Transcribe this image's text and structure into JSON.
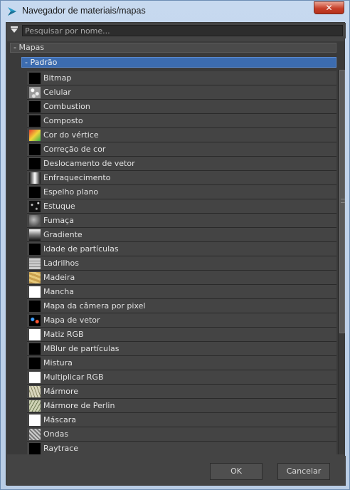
{
  "window": {
    "title": "Navegador de materiais/mapas",
    "close_label": "✕"
  },
  "search": {
    "placeholder": "Pesquisar por nome..."
  },
  "tree": {
    "group_label": "- Mapas",
    "subgroup_label": "- Padrão",
    "items": [
      {
        "label": "Bitmap",
        "thumb": "black"
      },
      {
        "label": "Celular",
        "thumb": "cellular"
      },
      {
        "label": "Combustion",
        "thumb": "black"
      },
      {
        "label": "Composto",
        "thumb": "black"
      },
      {
        "label": "Cor do vértice",
        "thumb": "vertex-color"
      },
      {
        "label": "Correção de cor",
        "thumb": "black"
      },
      {
        "label": "Deslocamento de vetor",
        "thumb": "black"
      },
      {
        "label": "Enfraquecimento",
        "thumb": "falloff"
      },
      {
        "label": "Espelho plano",
        "thumb": "black"
      },
      {
        "label": "Estuque",
        "thumb": "stucco"
      },
      {
        "label": "Fumaça",
        "thumb": "smoke"
      },
      {
        "label": "Gradiente",
        "thumb": "gradient"
      },
      {
        "label": "Idade de partículas",
        "thumb": "black"
      },
      {
        "label": "Ladrilhos",
        "thumb": "tiles"
      },
      {
        "label": "Madeira",
        "thumb": "wood"
      },
      {
        "label": "Mancha",
        "thumb": "white"
      },
      {
        "label": "Mapa da câmera por pixel",
        "thumb": "black"
      },
      {
        "label": "Mapa de vetor",
        "thumb": "vector-map"
      },
      {
        "label": "Matiz RGB",
        "thumb": "white"
      },
      {
        "label": "MBlur de partículas",
        "thumb": "black"
      },
      {
        "label": "Mistura",
        "thumb": "black"
      },
      {
        "label": "Multiplicar RGB",
        "thumb": "white"
      },
      {
        "label": "Mármore",
        "thumb": "marble"
      },
      {
        "label": "Mármore de Perlin",
        "thumb": "perlin-marble"
      },
      {
        "label": "Máscara",
        "thumb": "white"
      },
      {
        "label": "Ondas",
        "thumb": "waves"
      },
      {
        "label": "Raytrace",
        "thumb": "black"
      }
    ]
  },
  "footer": {
    "ok_label": "OK",
    "cancel_label": "Cancelar"
  }
}
